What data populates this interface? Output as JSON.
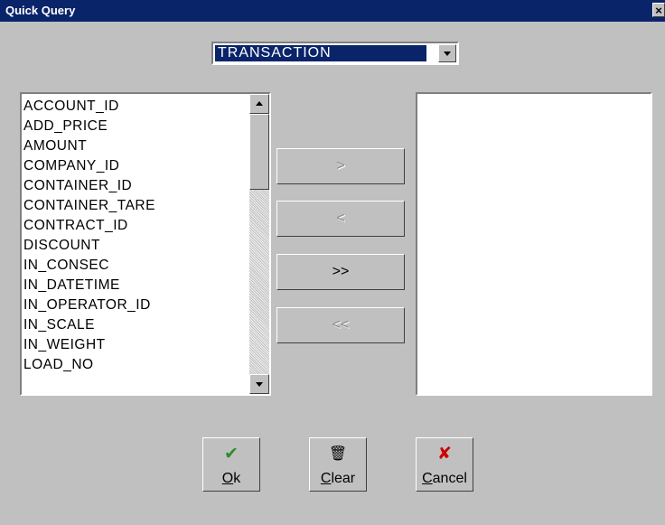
{
  "window": {
    "title": "Quick Query",
    "close_glyph": "×"
  },
  "table_select": {
    "value": "TRANSACTION"
  },
  "available_fields": {
    "items": [
      "ACCOUNT_ID",
      "ADD_PRICE",
      "AMOUNT",
      "COMPANY_ID",
      "CONTAINER_ID",
      "CONTAINER_TARE",
      "CONTRACT_ID",
      "DISCOUNT",
      "IN_CONSEC",
      "IN_DATETIME",
      "IN_OPERATOR_ID",
      "IN_SCALE",
      "IN_WEIGHT",
      "LOAD_NO"
    ]
  },
  "selected_fields": {
    "items": []
  },
  "move_buttons": {
    "add_one": ">",
    "remove_one": "<",
    "add_all": ">>",
    "remove_all": "<<"
  },
  "actions": {
    "ok": {
      "label": "Ok",
      "icon": "check-icon",
      "icon_glyph": "✔",
      "color": "#2e8b2e"
    },
    "clear": {
      "label": "Clear",
      "icon": "eraser-icon",
      "icon_glyph": "🗑",
      "color": "#000000"
    },
    "cancel": {
      "label": "Cancel",
      "icon": "x-icon",
      "icon_glyph": "✘",
      "color": "#cc0000"
    }
  },
  "colors": {
    "titlebar": "#0a246a",
    "face": "#c0c0c0",
    "selection": "#0a246a"
  }
}
